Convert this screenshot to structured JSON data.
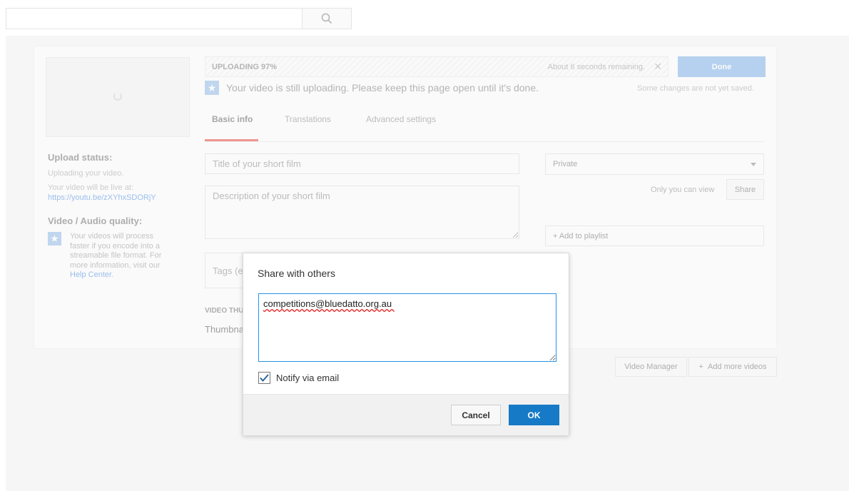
{
  "search": {
    "placeholder": "",
    "value": ""
  },
  "upload": {
    "label": "UPLOADING 97%",
    "progress_percent": 97,
    "remaining": "About 6 seconds remaining.",
    "done_label": "Done",
    "notice": "Your video is still uploading. Please keep this page open until it's done.",
    "unsaved": "Some changes are not yet saved."
  },
  "tabs": [
    {
      "label": "Basic info",
      "active": true
    },
    {
      "label": "Translations",
      "active": false
    },
    {
      "label": "Advanced settings",
      "active": false
    }
  ],
  "left": {
    "upload_status_heading": "Upload status:",
    "upload_status_text": "Uploading your video.",
    "live_at_text": "Your video will be live at:",
    "live_link": "https://youtu.be/zXYhxSDORjY",
    "quality_heading": "Video / Audio quality:",
    "quality_text": "Your videos will process faster if you encode into a streamable file format. For more information, visit our",
    "help_link": "Help Center",
    "help_suffix": "."
  },
  "form": {
    "title_placeholder": "Title of your short film",
    "desc_placeholder": "Description of your short film",
    "tags_placeholder": "Tags (e",
    "privacy_value": "Private",
    "only_you": "Only you can view",
    "share_label": "Share",
    "playlist_label": "+ Add to playlist",
    "video_thumb_label": "VIDEO THU",
    "thumbnail_text": "Thumbna"
  },
  "bottom": {
    "video_manager": "Video Manager",
    "add_more": "Add more videos"
  },
  "dialog": {
    "title": "Share with others",
    "emails": "competitions@bluedatto.org.au ",
    "notify_label": "Notify via email",
    "notify_checked": true,
    "cancel_label": "Cancel",
    "ok_label": "OK"
  },
  "colors": {
    "accent_blue": "#167ac6",
    "focus_blue": "#2793e6",
    "red_tab": "#e62117"
  }
}
